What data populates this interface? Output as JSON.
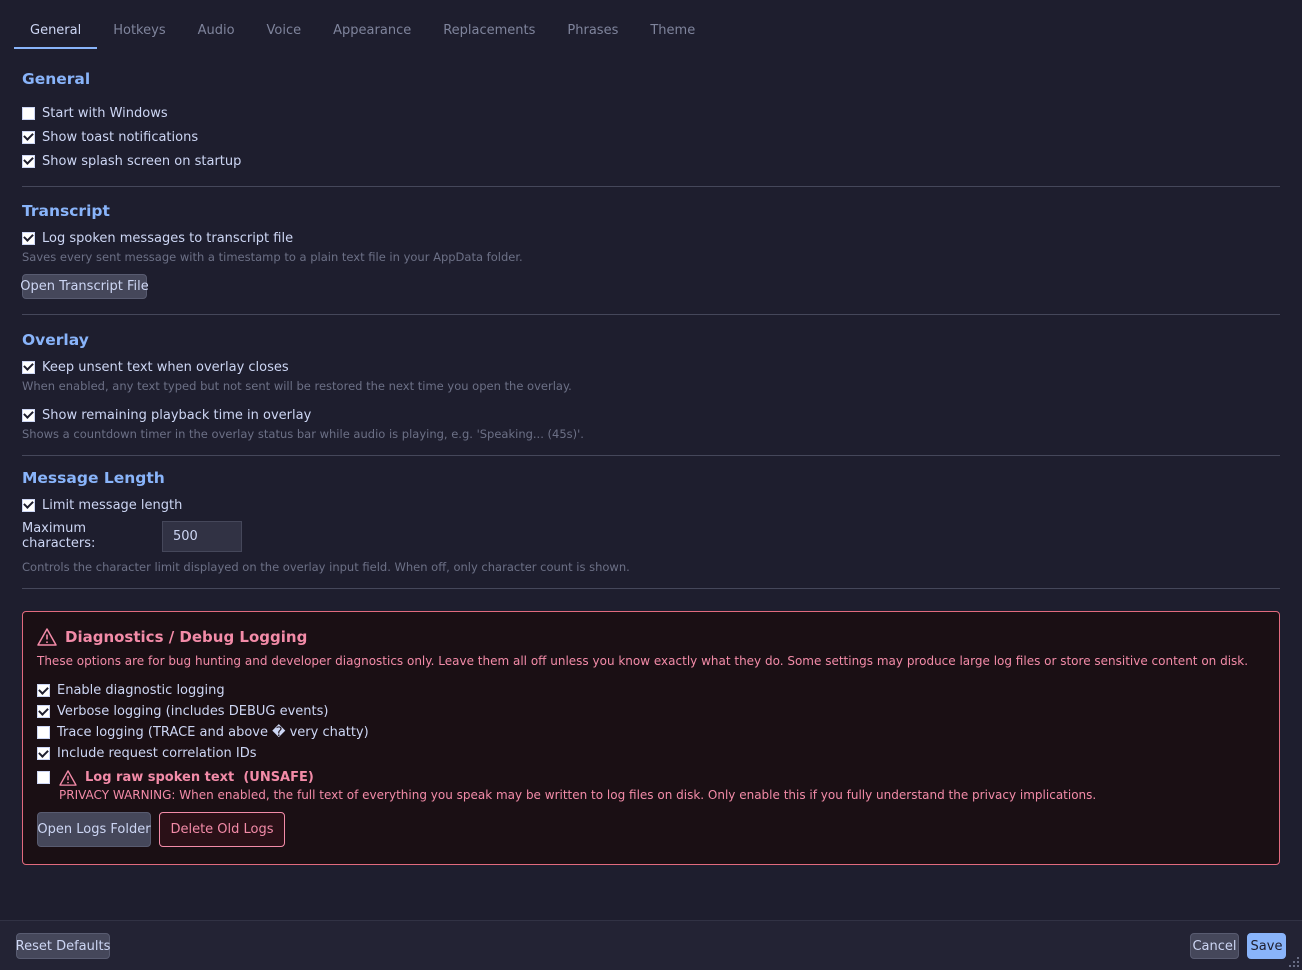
{
  "tabs": [
    {
      "label": "General",
      "active": true
    },
    {
      "label": "Hotkeys",
      "active": false
    },
    {
      "label": "Audio",
      "active": false
    },
    {
      "label": "Voice",
      "active": false
    },
    {
      "label": "Appearance",
      "active": false
    },
    {
      "label": "Replacements",
      "active": false
    },
    {
      "label": "Phrases",
      "active": false
    },
    {
      "label": "Theme",
      "active": false
    }
  ],
  "general": {
    "title": "General",
    "start_with_windows": {
      "label": "Start with Windows",
      "checked": false
    },
    "show_toast": {
      "label": "Show toast notifications",
      "checked": true
    },
    "show_splash": {
      "label": "Show splash screen on startup",
      "checked": true
    }
  },
  "transcript": {
    "title": "Transcript",
    "log_messages": {
      "label": "Log spoken messages to transcript file",
      "checked": true
    },
    "hint": "Saves every sent message with a timestamp to a plain text file in your AppData folder.",
    "open_button": "Open Transcript File"
  },
  "overlay": {
    "title": "Overlay",
    "keep_unsent": {
      "label": "Keep unsent text when overlay closes",
      "checked": true
    },
    "keep_unsent_hint": "When enabled, any text typed but not sent will be restored the next time you open the overlay.",
    "show_remaining": {
      "label": "Show remaining playback time in overlay",
      "checked": true
    },
    "show_remaining_hint": "Shows a countdown timer in the overlay status bar while audio is playing, e.g. 'Speaking...  (45s)'."
  },
  "message_length": {
    "title": "Message Length",
    "limit": {
      "label": "Limit message length",
      "checked": true
    },
    "max_label": "Maximum characters:",
    "max_value": "500",
    "hint": "Controls the character limit displayed on the overlay input field. When off, only character count is shown."
  },
  "diagnostics": {
    "title": "Diagnostics / Debug Logging",
    "description": "These options are for bug hunting and developer diagnostics only. Leave them all off unless you know exactly what they do. Some settings may produce large log files or store sensitive content on disk.",
    "enable": {
      "label": "Enable diagnostic logging",
      "checked": true
    },
    "verbose": {
      "label": "Verbose logging (includes DEBUG events)",
      "checked": true
    },
    "trace": {
      "label": "Trace logging (TRACE and above � very chatty)",
      "checked": false
    },
    "correlation": {
      "label": "Include request correlation IDs",
      "checked": true
    },
    "raw_text": {
      "label": "Log raw spoken text  (UNSAFE)",
      "checked": false
    },
    "privacy_warning": "PRIVACY WARNING: When enabled, the full text of everything you speak may be written to log files on disk. Only enable this if you fully understand the privacy implications.",
    "open_logs_button": "Open Logs Folder",
    "delete_logs_button": "Delete Old Logs"
  },
  "footer": {
    "reset_button": "Reset Defaults",
    "cancel_button": "Cancel",
    "save_button": "Save"
  },
  "colors": {
    "background": "#1e1e2e",
    "accent": "#89b4fa",
    "danger": "#f38ba8",
    "hint_text": "#6c7086"
  },
  "icons": {
    "warning": "warning-triangle-icon",
    "resize": "resize-grip-icon"
  }
}
